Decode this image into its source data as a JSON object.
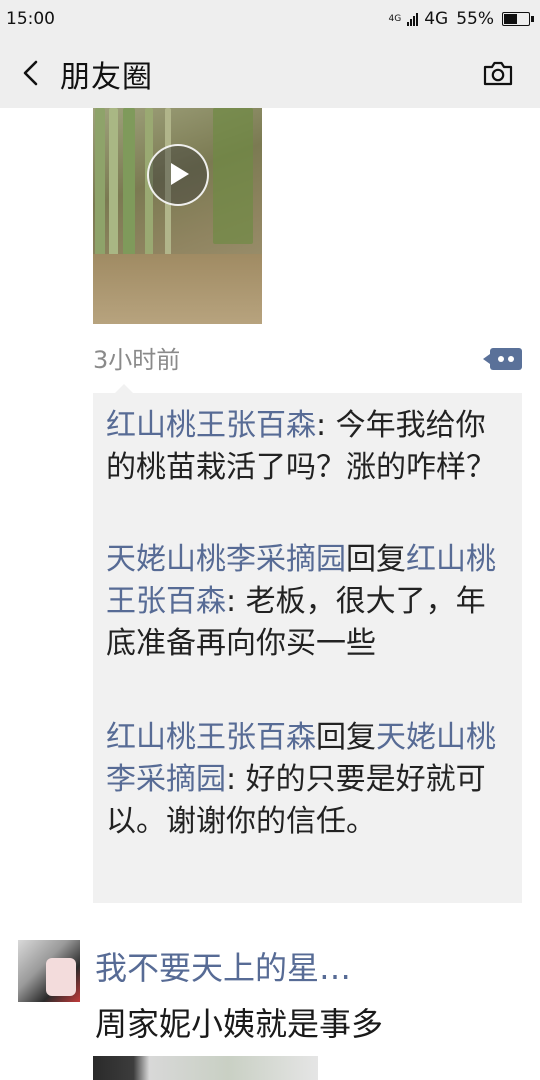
{
  "status_bar": {
    "time": "15:00",
    "network_small": "4G",
    "network": "4G",
    "battery": "55%",
    "battery_level": 0.55
  },
  "header": {
    "back_icon": "chevron-left-icon",
    "title": "朋友圈",
    "camera_icon": "camera-icon"
  },
  "post": {
    "media_icon": "play-icon",
    "time_ago": "3小时前",
    "comment_icon": "comment-dots-icon",
    "comments": [
      {
        "author": "红山桃王张百森",
        "reply_word": "",
        "reply_to": "",
        "separator": ": ",
        "text": "今年我给你的桃苗栽活了吗？涨的咋样？"
      },
      {
        "author": "天姥山桃李采摘园",
        "reply_word": "回复",
        "reply_to": "红山桃王张百森",
        "separator": ": ",
        "text": "老板，很大了，年底准备再向你买一些"
      },
      {
        "author": "红山桃王张百森",
        "reply_word": "回复",
        "reply_to": "天姥山桃李采摘园",
        "separator": ": ",
        "text": "好的只要是好就可以。谢谢你的信任。"
      }
    ]
  },
  "next_post": {
    "name": "我不要天上的星…",
    "text": "周家妮小姨就是事多"
  },
  "colors": {
    "link": "#576b95",
    "bar_bg": "#eeeeee",
    "comment_bg": "#f1f1f1"
  }
}
